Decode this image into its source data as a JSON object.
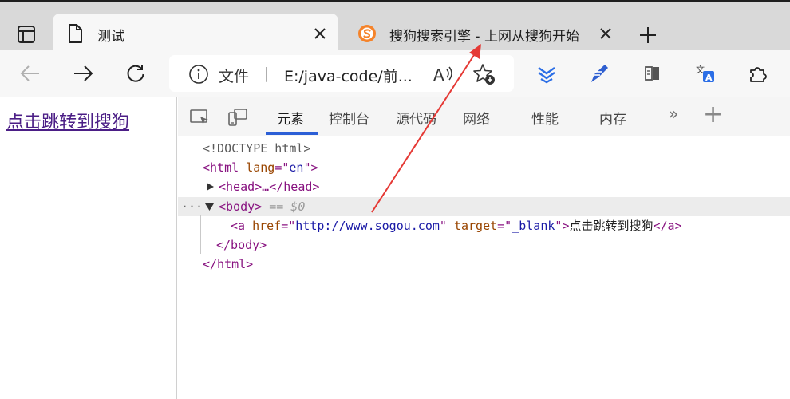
{
  "tabs": [
    {
      "title": "测试",
      "favicon": "page-icon",
      "active": true
    },
    {
      "title": "搜狗搜索引擎 - 上网从搜狗开始",
      "favicon": "sogou-logo-icon",
      "active": false
    }
  ],
  "addressbar": {
    "info_label": "文件",
    "separator": "|",
    "url": "E:/java-code/前..."
  },
  "page": {
    "link_text": "点击跳转到搜狗"
  },
  "devtools": {
    "tabs": [
      "元素",
      "控制台",
      "源代码",
      "网络",
      "性能",
      "内存"
    ],
    "active_tab": "元素",
    "more_label": "»",
    "add_label": "+",
    "code": {
      "doctype": "<!DOCTYPE html>",
      "html_open_tag": "html",
      "lang_attr": "lang",
      "lang_val": "en",
      "head_collapsed": "<head>…</head>",
      "body_tag": "body",
      "body_hint": "== $0",
      "a_tag": "a",
      "href_attr": "href",
      "href_val": "http://www.sogou.com",
      "target_attr": "target",
      "target_val": "_blank",
      "a_text": "点击跳转到搜狗",
      "body_close": "</body>",
      "html_close": "</html>"
    }
  },
  "colors": {
    "annotation_arrow": "#e53935",
    "devtools_active_underline": "#2c5fd6",
    "link": "#4b1e86"
  }
}
